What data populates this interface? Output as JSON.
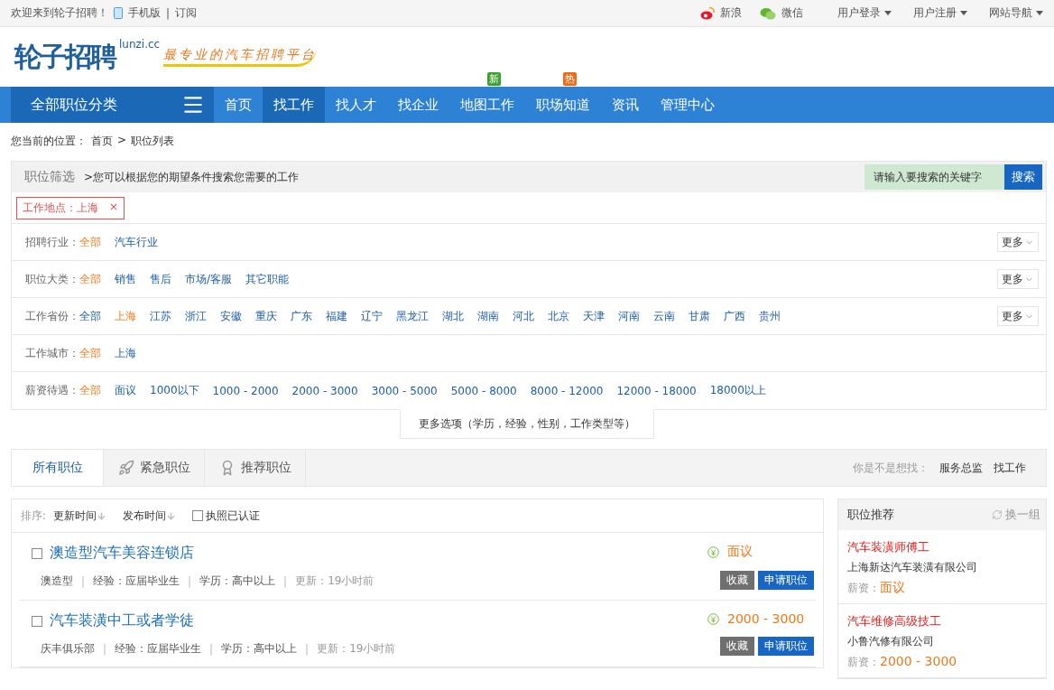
{
  "top_bar": {
    "welcome": "欢迎来到轮子招聘！",
    "links": [
      "手机版",
      "订阅"
    ],
    "separator": "|",
    "social": [
      {
        "label": "新浪",
        "kind": "weibo"
      },
      {
        "label": "微信",
        "kind": "wechat"
      }
    ],
    "menus": [
      "用户登录",
      "用户注册",
      "网站导航"
    ]
  },
  "logo": {
    "name": "轮子招聘",
    "domain": "lunzi.cc",
    "slogan": "最专业的汽车招聘平台"
  },
  "nav": {
    "category": "全部职位分类",
    "items": [
      {
        "label": "首页",
        "selected": false
      },
      {
        "label": "找工作",
        "selected": true
      },
      {
        "label": "找人才",
        "selected": false
      },
      {
        "label": "找企业",
        "selected": false
      },
      {
        "label": "地图工作",
        "selected": false,
        "badge": "新",
        "color": "#3aa02e"
      },
      {
        "label": "职场知道",
        "selected": false,
        "badge": "热",
        "color": "#f06a14"
      },
      {
        "label": "资讯",
        "selected": false
      },
      {
        "label": "管理中心",
        "selected": false
      }
    ]
  },
  "breadcrumb": {
    "label": "您当前的位置：",
    "items": [
      "首页",
      "职位列表"
    ],
    "separator": ">"
  },
  "filter": {
    "title": "职位筛选",
    "hint": ">您可以根据您的期望条件搜索您需要的工作",
    "search": {
      "placeholder": "请输入要搜索的关键字",
      "button": "搜索"
    },
    "active_tag": {
      "label": "工作地点：上海",
      "remove": "×"
    },
    "rows": [
      {
        "label": "招聘行业：",
        "more": "更多",
        "options": [
          {
            "label": "全部",
            "selected": true
          },
          {
            "label": "汽车行业",
            "selected": false
          }
        ]
      },
      {
        "label": "职位大类：",
        "more": "更多",
        "options": [
          {
            "label": "全部",
            "selected": true
          },
          {
            "label": "销售",
            "selected": false
          },
          {
            "label": "售后",
            "selected": false
          },
          {
            "label": "市场/客服",
            "selected": false
          },
          {
            "label": "其它职能",
            "selected": false
          }
        ]
      },
      {
        "label": "工作省份：",
        "more": "更多",
        "options": [
          {
            "label": "全部",
            "selected": false
          },
          {
            "label": "上海",
            "selected": true
          },
          {
            "label": "江苏",
            "selected": false
          },
          {
            "label": "浙江",
            "selected": false
          },
          {
            "label": "安徽",
            "selected": false
          },
          {
            "label": "重庆",
            "selected": false
          },
          {
            "label": "广东",
            "selected": false
          },
          {
            "label": "福建",
            "selected": false
          },
          {
            "label": "辽宁",
            "selected": false
          },
          {
            "label": "黑龙江",
            "selected": false
          },
          {
            "label": "湖北",
            "selected": false
          },
          {
            "label": "湖南",
            "selected": false
          },
          {
            "label": "河北",
            "selected": false
          },
          {
            "label": "北京",
            "selected": false
          },
          {
            "label": "天津",
            "selected": false
          },
          {
            "label": "河南",
            "selected": false
          },
          {
            "label": "云南",
            "selected": false
          },
          {
            "label": "甘肃",
            "selected": false
          },
          {
            "label": "广西",
            "selected": false
          },
          {
            "label": "贵州",
            "selected": false
          }
        ]
      },
      {
        "label": "工作城市：",
        "options": [
          {
            "label": "全部",
            "selected": true
          },
          {
            "label": "上海",
            "selected": false
          }
        ]
      },
      {
        "label": "薪资待遇：",
        "options": [
          {
            "label": "全部",
            "selected": true
          },
          {
            "label": "面议",
            "selected": false
          },
          {
            "label": "1000以下",
            "selected": false
          },
          {
            "label": "1000 - 2000",
            "selected": false
          },
          {
            "label": "2000 - 3000",
            "selected": false
          },
          {
            "label": "3000 - 5000",
            "selected": false
          },
          {
            "label": "5000 - 8000",
            "selected": false
          },
          {
            "label": "8000 - 12000",
            "selected": false
          },
          {
            "label": "12000 - 18000",
            "selected": false
          },
          {
            "label": "18000以上",
            "selected": false
          }
        ]
      }
    ],
    "more_options": "更多选项（学历，经验，性别，工作类型等）"
  },
  "tabs": [
    {
      "label": "所有职位",
      "selected": true
    },
    {
      "label": "紧急职位",
      "selected": false,
      "kind": "rocket"
    },
    {
      "label": "推荐职位",
      "selected": false,
      "kind": "medal"
    }
  ],
  "suggest": {
    "label": "你是不是想找：",
    "links": [
      "服务总监",
      "找工作"
    ]
  },
  "sort": {
    "label": "排序:",
    "items": [
      "更新时间",
      "发布时间"
    ],
    "license": {
      "label": "执照已认证",
      "checked": false
    }
  },
  "jobs": [
    {
      "title": "澳造型汽车美容连锁店",
      "checked": false,
      "separator": "|",
      "meta": [
        "澳造型",
        "经验：应届毕业生",
        "学历：高中以上",
        "更新：19小时前"
      ],
      "salary": "面议",
      "actions": [
        "收藏",
        "申请职位"
      ]
    },
    {
      "title": "汽车装潢中工或者学徒",
      "checked": false,
      "separator": "|",
      "meta": [
        "庆丰俱乐部",
        "经验：应届毕业生",
        "学历：高中以上",
        "更新：19小时前"
      ],
      "salary": "2000 - 3000",
      "actions": [
        "收藏",
        "申请职位"
      ]
    }
  ],
  "side": {
    "title": "职位推荐",
    "refresh": "换一组",
    "items": [
      {
        "title": "汽车装潢师傅工",
        "company": "上海新达汽车装潢有限公司",
        "salary_label": "薪资：",
        "salary": "面议"
      },
      {
        "title": "汽车维修高级技工",
        "company": "小鲁汽修有限公司",
        "salary_label": "薪资：",
        "salary": "2000 - 3000"
      }
    ]
  }
}
